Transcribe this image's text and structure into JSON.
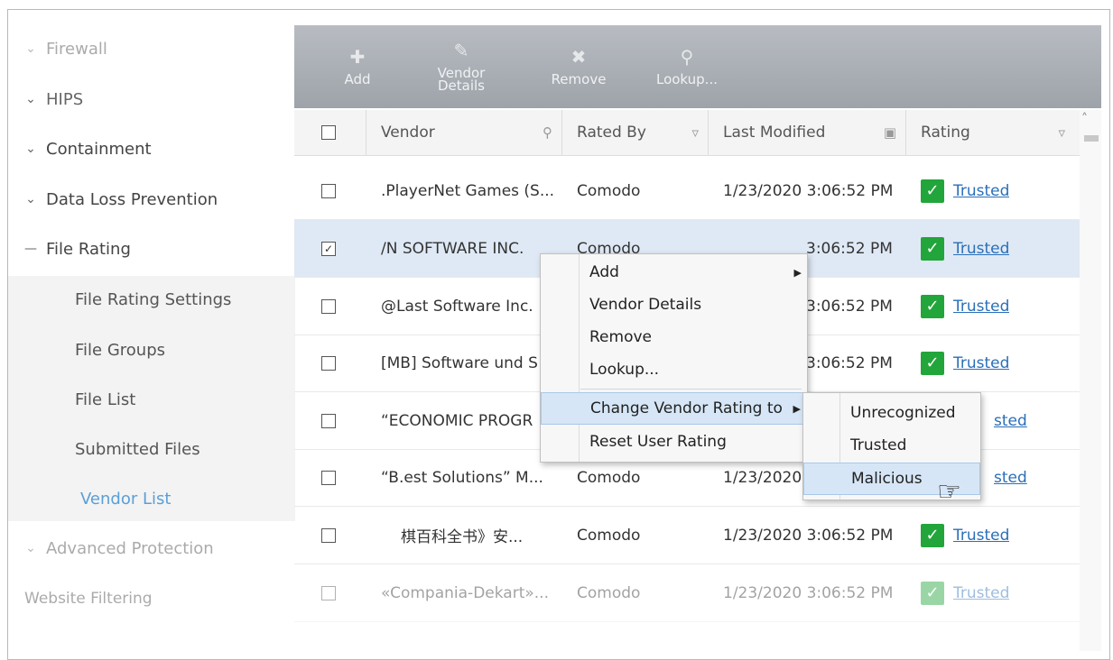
{
  "sidebar": {
    "items": [
      {
        "label": "Firewall",
        "icon": "chevron-down-icon"
      },
      {
        "label": "HIPS",
        "icon": "chevron-down-icon"
      },
      {
        "label": "Containment",
        "icon": "chevron-down-icon"
      },
      {
        "label": "Data Loss Prevention",
        "icon": "chevron-down-icon"
      },
      {
        "label": "File Rating",
        "icon": "minus-icon"
      },
      {
        "label": "Advanced Protection",
        "icon": "chevron-down-icon"
      },
      {
        "label": "Website Filtering",
        "icon": ""
      }
    ],
    "file_rating_sub": [
      "File Rating Settings",
      "File Groups",
      "File List",
      "Submitted Files",
      "Vendor List"
    ],
    "active_sub": "Vendor List"
  },
  "toolbar": {
    "add": "Add",
    "vendor_details_1": "Vendor",
    "vendor_details_2": "Details",
    "remove": "Remove",
    "lookup": "Lookup..."
  },
  "table": {
    "headers": {
      "vendor": "Vendor",
      "rated_by": "Rated By",
      "last_modified": "Last Modified",
      "rating": "Rating"
    },
    "rows": [
      {
        "vendor": ".PlayerNet Games (S...",
        "rated_by": "Comodo",
        "modified": "1/23/2020 3:06:52 PM",
        "rating": "Trusted",
        "checked": false
      },
      {
        "vendor": "/N SOFTWARE INC.",
        "rated_by": "Comodo",
        "modified": "3:06:52 PM",
        "rating": "Trusted",
        "checked": true
      },
      {
        "vendor": "@Last Software Inc.",
        "rated_by": "",
        "modified": "3:06:52 PM",
        "rating": "Trusted",
        "checked": false
      },
      {
        "vendor": "[MB] Software und S",
        "rated_by": "",
        "modified": "3:06:52 PM",
        "rating": "Trusted",
        "checked": false
      },
      {
        "vendor": "“ECONOMIC PROGR",
        "rated_by": "",
        "modified": "",
        "rating": "sted",
        "checked": false
      },
      {
        "vendor": "“B.est Solutions” M...",
        "rated_by": "Comodo",
        "modified": "1/23/2020",
        "rating": "sted",
        "checked": false
      },
      {
        "vendor": "棋百科全书》安...",
        "rated_by": "Comodo",
        "modified": "1/23/2020 3:06:52 PM",
        "rating": "Trusted",
        "checked": false
      },
      {
        "vendor": "«Compania-Dekart»...",
        "rated_by": "Comodo",
        "modified": "1/23/2020 3:06:52 PM",
        "rating": "Trusted",
        "checked": false
      }
    ]
  },
  "context_menu": {
    "items": [
      "Add",
      "Vendor Details",
      "Remove",
      "Lookup...",
      "Change Vendor Rating to",
      "Reset User Rating"
    ],
    "submenu": [
      "Unrecognized",
      "Trusted",
      "Malicious"
    ]
  }
}
